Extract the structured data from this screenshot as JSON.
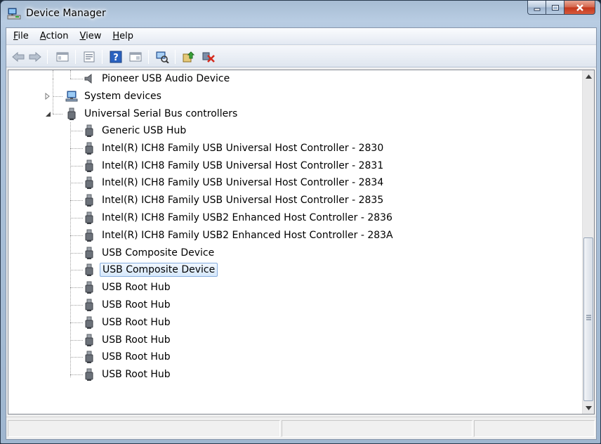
{
  "window": {
    "title": "Device Manager"
  },
  "menu": [
    {
      "label": "File",
      "accel": "F",
      "rest": "ile"
    },
    {
      "label": "Action",
      "accel": "A",
      "rest": "ction"
    },
    {
      "label": "View",
      "accel": "V",
      "rest": "iew"
    },
    {
      "label": "Help",
      "accel": "H",
      "rest": "elp"
    }
  ],
  "toolbar": {
    "buttons": [
      "back-icon",
      "forward-icon",
      "show-hide-console-tree-icon",
      "properties-icon",
      "help-icon",
      "view-icon",
      "scan-hardware-icon",
      "update-driver-icon",
      "uninstall-icon"
    ]
  },
  "tree": {
    "audio_device": "Pioneer USB Audio Device",
    "system_devices": "System devices",
    "usb_controllers": "Universal Serial Bus controllers",
    "usb_children": [
      "Generic USB Hub",
      "Intel(R) ICH8 Family USB Universal Host Controller - 2830",
      "Intel(R) ICH8 Family USB Universal Host Controller - 2831",
      "Intel(R) ICH8 Family USB Universal Host Controller - 2834",
      "Intel(R) ICH8 Family USB Universal Host Controller - 2835",
      "Intel(R) ICH8 Family USB2 Enhanced Host Controller - 2836",
      "Intel(R) ICH8 Family USB2 Enhanced Host Controller - 283A",
      "USB Composite Device",
      "USB Composite Device",
      "USB Root Hub",
      "USB Root Hub",
      "USB Root Hub",
      "USB Root Hub",
      "USB Root Hub",
      "USB Root Hub"
    ],
    "selected_index": 8
  },
  "colors": {
    "selection_border": "#84acdd",
    "selection_fill": "#d6e8fc",
    "close_button": "#c2361b"
  }
}
